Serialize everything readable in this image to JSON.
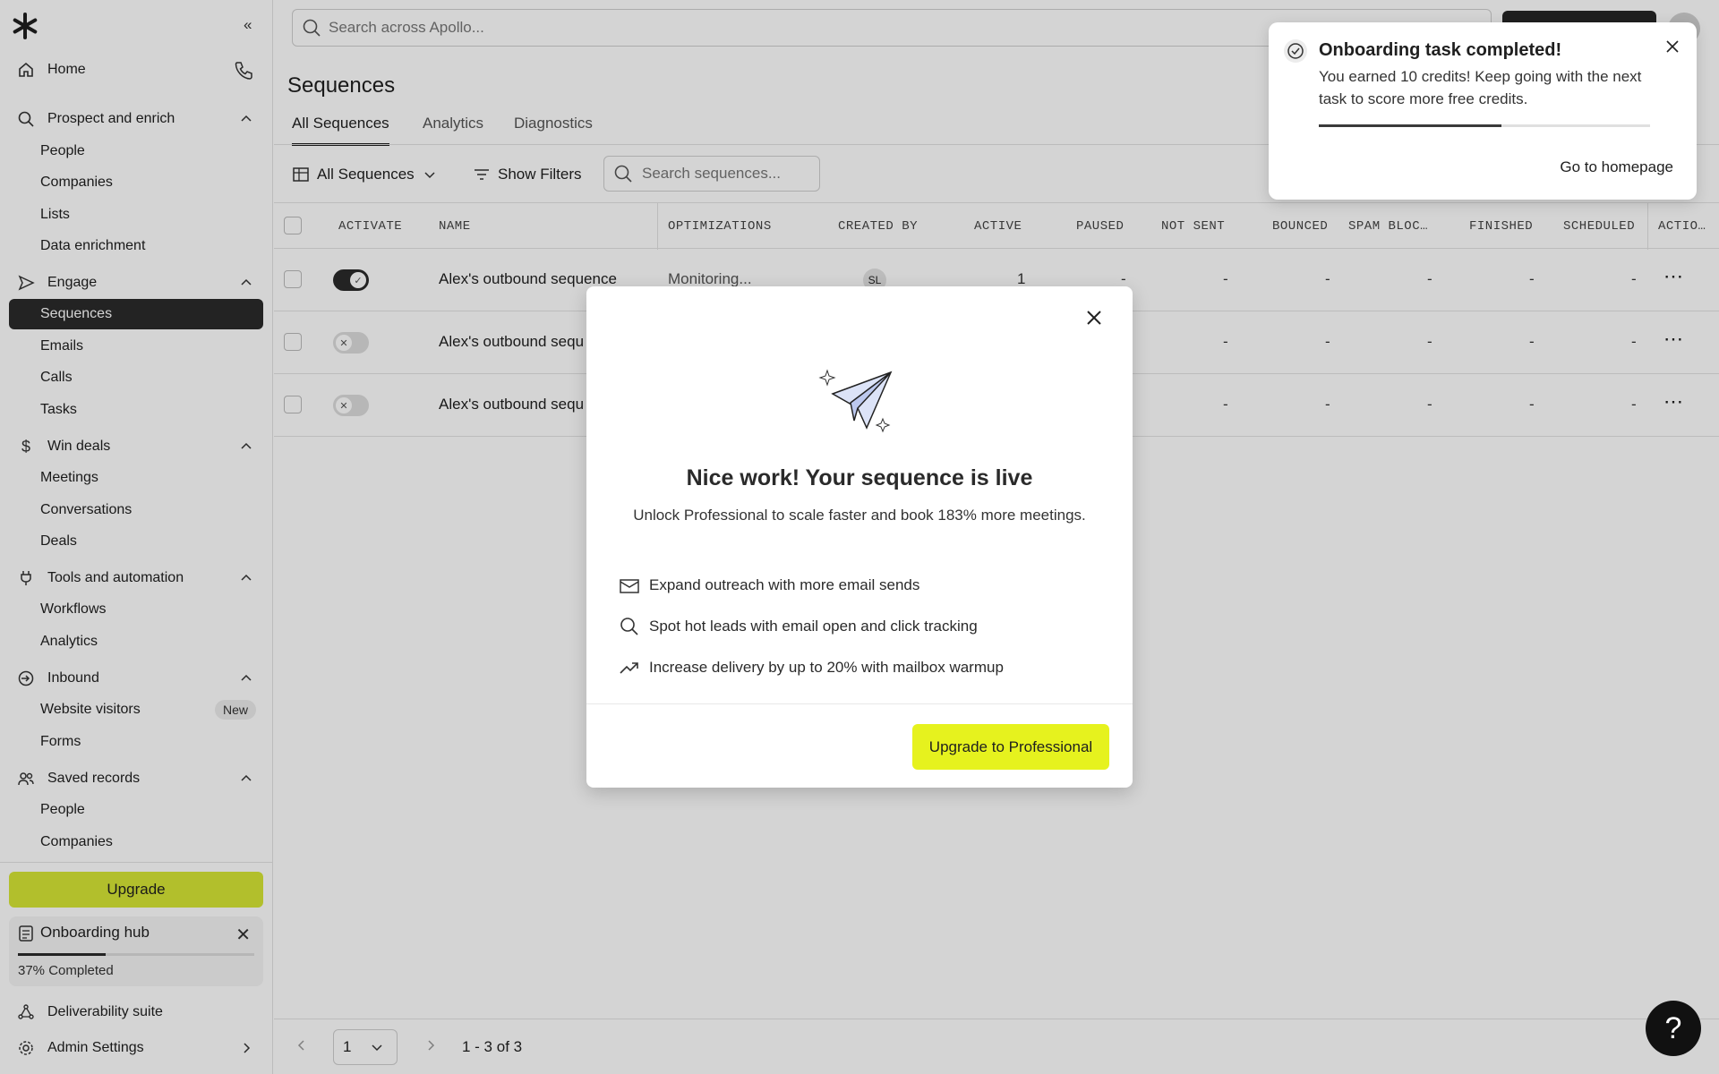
{
  "sidebar": {
    "home": "Home",
    "prospect": {
      "label": "Prospect and enrich",
      "items": [
        "People",
        "Companies",
        "Lists",
        "Data enrichment"
      ]
    },
    "engage": {
      "label": "Engage",
      "items": [
        "Sequences",
        "Emails",
        "Calls",
        "Tasks"
      ],
      "active": "Sequences"
    },
    "win": {
      "label": "Win deals",
      "items": [
        "Meetings",
        "Conversations",
        "Deals"
      ]
    },
    "tools": {
      "label": "Tools and automation",
      "items": [
        "Workflows",
        "Analytics"
      ]
    },
    "inbound": {
      "label": "Inbound",
      "items": [
        "Website visitors",
        "Forms"
      ],
      "badge": "New"
    },
    "saved": {
      "label": "Saved records",
      "items": [
        "People",
        "Companies"
      ]
    },
    "upgrade": "Upgrade",
    "onboarding": {
      "title": "Onboarding hub",
      "progress_text": "37% Completed",
      "progress": 0.37
    },
    "deliverability": "Deliverability suite",
    "admin": "Admin Settings"
  },
  "header": {
    "search_placeholder": "Search across Apollo..."
  },
  "page": {
    "title": "Sequences",
    "tabs": [
      "All Sequences",
      "Analytics",
      "Diagnostics"
    ],
    "view_select": "All Sequences",
    "show_filters": "Show Filters",
    "seq_search_placeholder": "Search sequences..."
  },
  "table": {
    "columns": [
      "ACTIVATE",
      "NAME",
      "OPTIMIZATIONS",
      "CREATED BY",
      "ACTIVE",
      "PAUSED",
      "NOT SENT",
      "BOUNCED",
      "SPAM BLOC…",
      "FINISHED",
      "SCHEDULED",
      "ACTIO…"
    ],
    "rows": [
      {
        "active_toggle": true,
        "name": "Alex's outbound sequence",
        "optimization": "Monitoring...",
        "created_by": "SL",
        "active": "1",
        "paused": "-",
        "not_sent": "-",
        "bounced": "-",
        "spam": "-",
        "finished": "-",
        "scheduled": "-"
      },
      {
        "active_toggle": false,
        "name": "Alex's outbound sequ",
        "not_sent": "-",
        "bounced": "-",
        "spam": "-",
        "finished": "-",
        "scheduled": "-"
      },
      {
        "active_toggle": false,
        "name": "Alex's outbound sequ",
        "not_sent": "-",
        "bounced": "-",
        "spam": "-",
        "finished": "-",
        "scheduled": "-"
      }
    ]
  },
  "pagination": {
    "page": "1",
    "range": "1 - 3 of 3"
  },
  "modal": {
    "title": "Nice work! Your sequence is live",
    "subtitle": "Unlock Professional to scale faster and book 183% more meetings.",
    "features": [
      "Expand outreach with more email sends",
      "Spot hot leads with email open and click tracking",
      "Increase delivery by up to 20% with mailbox warmup"
    ],
    "cta": "Upgrade to Professional"
  },
  "toast": {
    "title": "Onboarding task completed!",
    "body": "You earned 10 credits! Keep going with the next task to score more free credits.",
    "progress": 0.55,
    "link": "Go to homepage"
  },
  "help": "?",
  "colors": {
    "accent": "#e6f21e",
    "sidebar_active": "#2b2b2b"
  }
}
